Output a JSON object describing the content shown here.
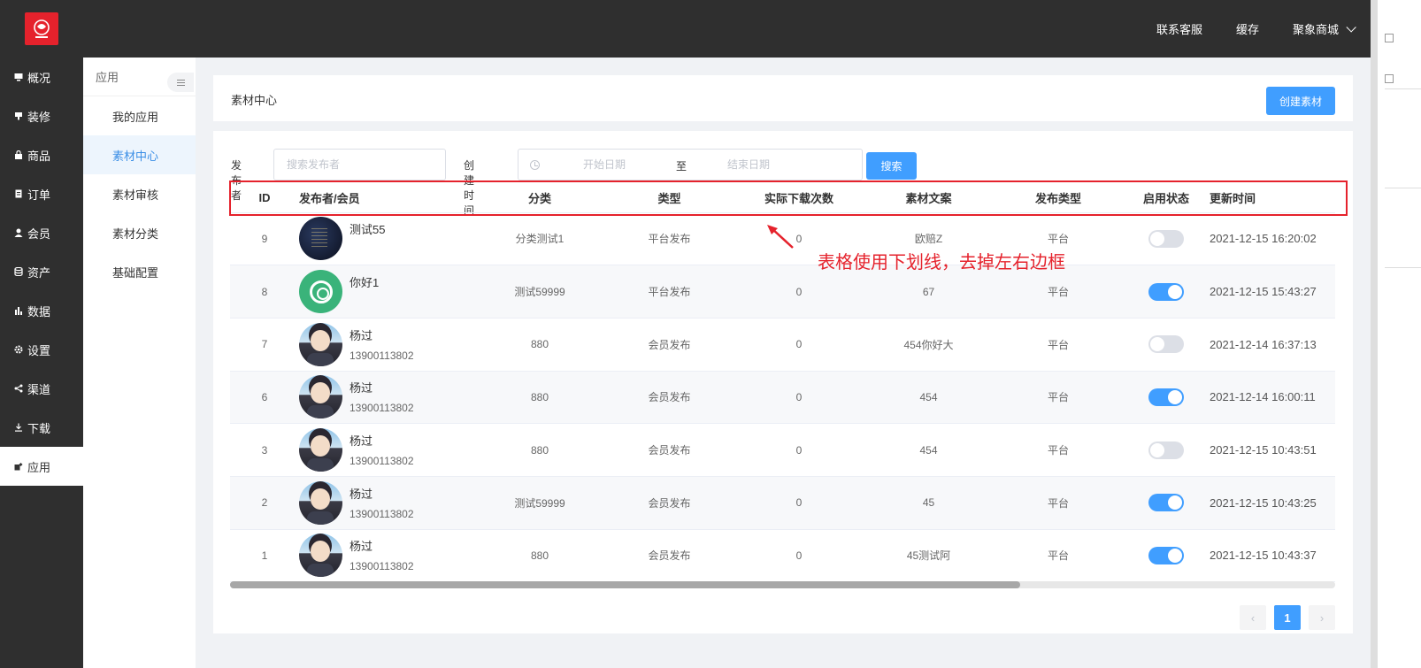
{
  "header": {
    "logo_text": "聚象商城",
    "nav": [
      "联系客服",
      "缓存"
    ],
    "shop_name": "聚象商城"
  },
  "sidebar": {
    "items": [
      {
        "label": "概况",
        "icon": "monitor-icon"
      },
      {
        "label": "装修",
        "icon": "brush-icon"
      },
      {
        "label": "商品",
        "icon": "bag-icon"
      },
      {
        "label": "订单",
        "icon": "order-icon"
      },
      {
        "label": "会员",
        "icon": "user-icon"
      },
      {
        "label": "资产",
        "icon": "database-icon"
      },
      {
        "label": "数据",
        "icon": "bar-chart-icon"
      },
      {
        "label": "设置",
        "icon": "gear-icon"
      },
      {
        "label": "渠道",
        "icon": "share-icon"
      },
      {
        "label": "下载",
        "icon": "download-icon"
      },
      {
        "label": "应用",
        "icon": "app-icon",
        "active": true
      }
    ]
  },
  "subnav": {
    "title": "应用",
    "items": [
      "我的应用",
      "素材中心",
      "素材审核",
      "素材分类",
      "基础配置"
    ],
    "active": "素材中心"
  },
  "page": {
    "title": "素材中心",
    "create_label": "创建素材"
  },
  "filters": {
    "publisher_label": "发布者",
    "publisher_placeholder": "搜索发布者",
    "time_label": "创建时间",
    "start_placeholder": "开始日期",
    "separator": "至",
    "end_placeholder": "结束日期",
    "search_label": "搜索"
  },
  "table": {
    "columns": [
      "ID",
      "发布者/会员",
      "分类",
      "类型",
      "实际下载次数",
      "素材文案",
      "发布类型",
      "启用状态",
      "更新时间"
    ],
    "rows": [
      {
        "id": "9",
        "name": "测试55",
        "phone": "",
        "avatar": "dark",
        "category": "分类测试1",
        "type": "平台发布",
        "downloads": "0",
        "copy": "欧赔Z",
        "publish_type": "平台",
        "enabled": false,
        "updated": "2021-12-15 16:20:02"
      },
      {
        "id": "8",
        "name": "你好1",
        "phone": "",
        "avatar": "green",
        "category": "测试59999",
        "type": "平台发布",
        "downloads": "0",
        "copy": "67",
        "publish_type": "平台",
        "enabled": true,
        "updated": "2021-12-15 15:43:27"
      },
      {
        "id": "7",
        "name": "杨过",
        "phone": "13900113802",
        "avatar": "anime",
        "category": "880",
        "type": "会员发布",
        "downloads": "0",
        "copy": "454你好大",
        "publish_type": "平台",
        "enabled": false,
        "updated": "2021-12-14 16:37:13"
      },
      {
        "id": "6",
        "name": "杨过",
        "phone": "13900113802",
        "avatar": "anime",
        "category": "880",
        "type": "会员发布",
        "downloads": "0",
        "copy": "454",
        "publish_type": "平台",
        "enabled": true,
        "updated": "2021-12-14 16:00:11"
      },
      {
        "id": "3",
        "name": "杨过",
        "phone": "13900113802",
        "avatar": "anime",
        "category": "880",
        "type": "会员发布",
        "downloads": "0",
        "copy": "454",
        "publish_type": "平台",
        "enabled": false,
        "updated": "2021-12-15 10:43:51"
      },
      {
        "id": "2",
        "name": "杨过",
        "phone": "13900113802",
        "avatar": "anime",
        "category": "测试59999",
        "type": "会员发布",
        "downloads": "0",
        "copy": "45",
        "publish_type": "平台",
        "enabled": true,
        "updated": "2021-12-15 10:43:25"
      },
      {
        "id": "1",
        "name": "杨过",
        "phone": "13900113802",
        "avatar": "anime",
        "category": "880",
        "type": "会员发布",
        "downloads": "0",
        "copy": "45测试阿",
        "publish_type": "平台",
        "enabled": true,
        "updated": "2021-12-15 10:43:37"
      }
    ]
  },
  "pagination": {
    "prev": "‹",
    "current": "1",
    "next": "›"
  },
  "annotation": {
    "text": "表格使用下划线，去掉左右边框",
    "color": "#e5222c"
  },
  "colors": {
    "primary": "#409eff",
    "sidebar_bg": "#2f2f2f",
    "brand_red": "#e5222c"
  }
}
